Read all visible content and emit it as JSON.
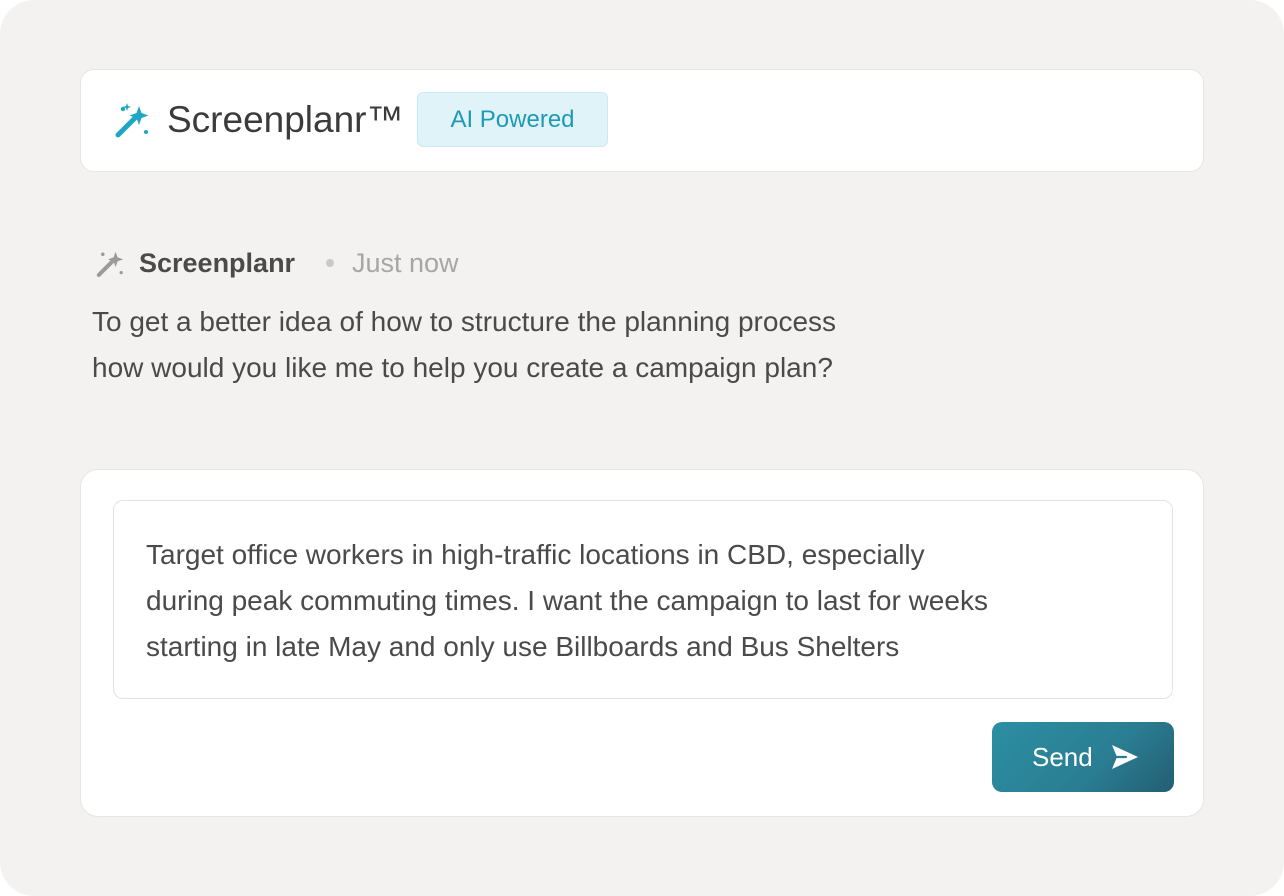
{
  "header": {
    "brand_name": "Screenplanr™",
    "badge": "AI Powered",
    "brand_icon": "magic-wand-icon"
  },
  "message": {
    "sender": "Screenplanr",
    "timestamp": "Just now",
    "sender_icon": "magic-wand-icon",
    "lines": [
      "To get a better idea of how to structure the planning process",
      "how would you like me to help you create a campaign plan?"
    ]
  },
  "composer": {
    "lines": [
      "Target office workers in high-traffic locations in CBD, especially",
      "during peak commuting times. I want the campaign to last for weeks",
      "starting in late May and only use Billboards and Bus Shelters"
    ],
    "send_label": "Send",
    "send_icon": "send-arrow-icon"
  },
  "colors": {
    "brand_accent": "#1fa6c4",
    "badge_bg": "#dff3f9",
    "button": "#2a7d92",
    "background": "#f4f2f0"
  }
}
